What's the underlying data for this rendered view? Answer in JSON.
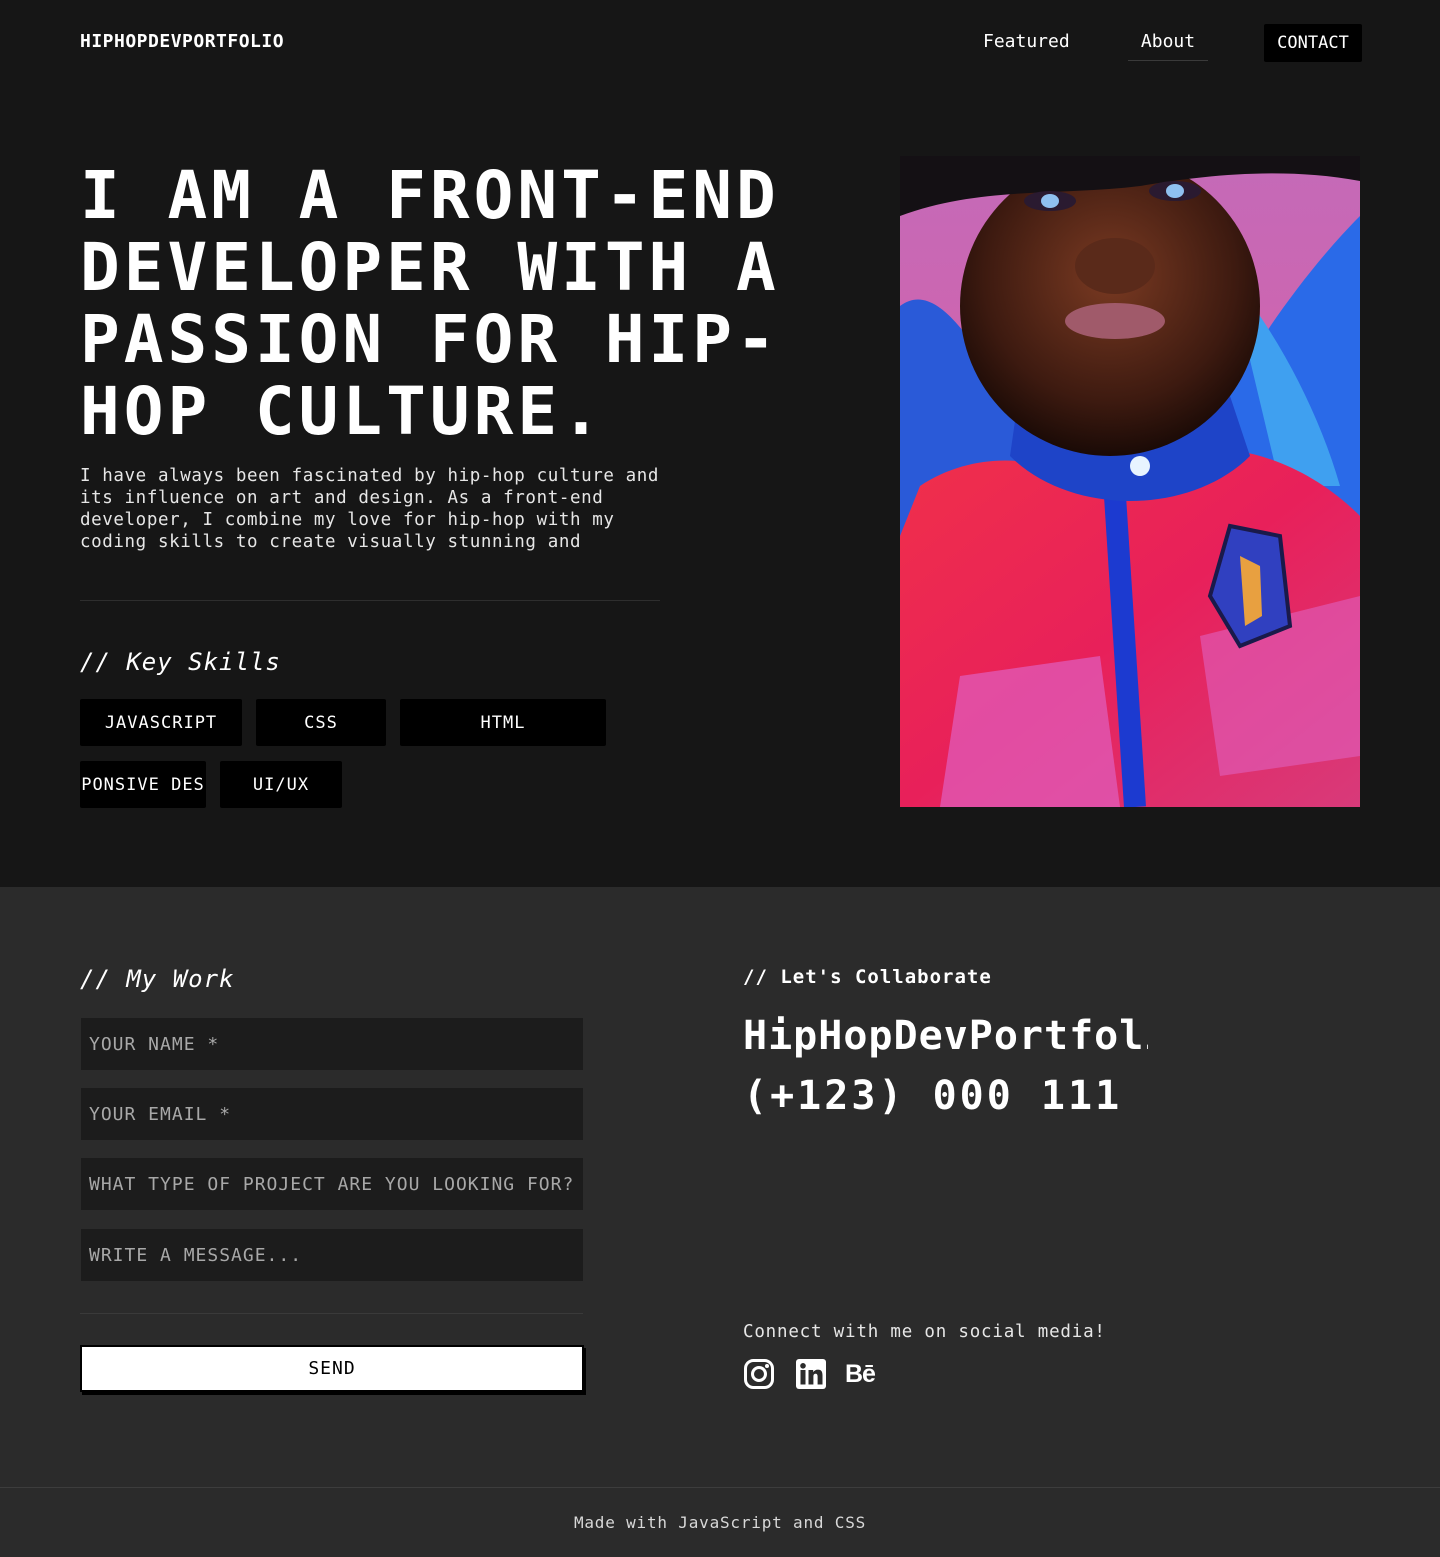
{
  "header": {
    "brand": "HIPHOPDEVPORTFOLIO",
    "nav": {
      "featured": "Featured",
      "about": "About",
      "contact": "CONTACT"
    }
  },
  "hero": {
    "title": "I AM A FRONT-END DEVELOPER WITH A PASSION FOR HIP-HOP CULTURE.",
    "description": "I have always been fascinated by hip-hop culture and its influence on art and design. As a front-end developer, I combine my love for hip-hop with my coding skills to create visually stunning and",
    "skills_heading": "// Key Skills",
    "skills": [
      "JAVASCRIPT",
      "CSS",
      "HTML",
      "RESPONSIVE DESIGN",
      "UI/UX"
    ]
  },
  "work": {
    "heading": "// My Work",
    "fields": {
      "name_placeholder": "YOUR NAME *",
      "email_placeholder": "YOUR EMAIL *",
      "project_placeholder": "WHAT TYPE OF PROJECT ARE YOU LOOKING FOR?",
      "message_placeholder": "WRITE A MESSAGE..."
    },
    "send_label": "SEND"
  },
  "collab": {
    "heading": "// Let's Collaborate",
    "name": "HipHopDevPortfolio",
    "phone": "(+123) 000 111",
    "social_text": "Connect with me on social media!",
    "social": [
      {
        "icon": "instagram-icon"
      },
      {
        "icon": "linkedin-icon"
      },
      {
        "icon": "behance-icon",
        "label": "Bē"
      }
    ]
  },
  "footer": {
    "text": "Made with JavaScript and CSS"
  },
  "colors": {
    "background": "#161616",
    "section_background": "#2b2b2b",
    "field_background": "#1c1c1c",
    "tag_background": "#000000",
    "text": "#ffffff"
  }
}
